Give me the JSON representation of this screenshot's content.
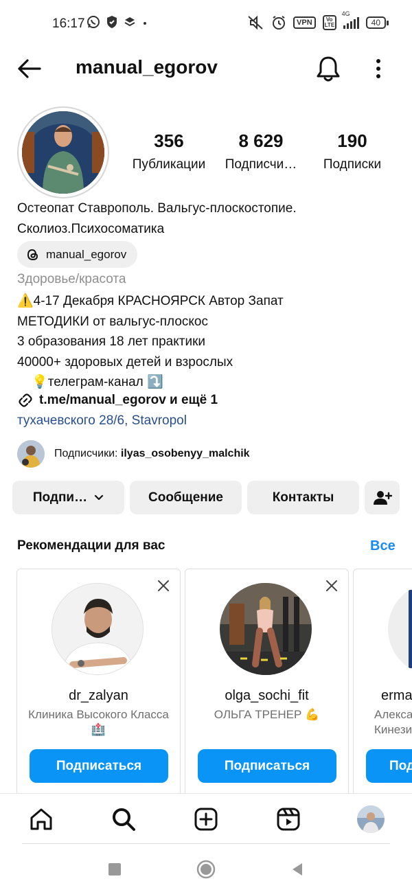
{
  "status_bar": {
    "time": "16:17",
    "left_icons": [
      "whatsapp-icon",
      "shield-icon",
      "layers-icon",
      "dot-icon"
    ],
    "right_icons": [
      "mute-icon",
      "alarm-icon",
      "vpn-badge",
      "volte-badge",
      "signal-4g-icon",
      "battery-icon"
    ],
    "vpn_label": "VPN",
    "volte_label": "Vo LTE",
    "network_label": "4G",
    "battery_level": "40"
  },
  "header": {
    "username": "manual_egorov",
    "back_icon": "arrow-left-icon",
    "bell_icon": "bell-icon",
    "more_icon": "more-vertical-icon"
  },
  "profile": {
    "stats": [
      {
        "value": "356",
        "label": "Публикации"
      },
      {
        "value": "8 629",
        "label": "Подписчи…"
      },
      {
        "value": "190",
        "label": "Подписки"
      }
    ],
    "name_line1": "Остеопат Ставрополь. Вальгус-плоскостопие.",
    "name_line2": "Сколиоз.Психосоматика",
    "threads_handle": "manual_egorov",
    "category": "Здоровье/красота",
    "bio": [
      "⚠️4-17 Декабря КРАСНОЯРСК Автор Запат",
      "МЕТОДИКИ от вальгус-плоскос",
      "3 образования 18 лет практики",
      "40000+ здоровых детей и взрослых",
      "    💡телеграм-канал ⤵️"
    ],
    "link": "t.me/manual_egorov и ещё 1",
    "address": "тухачевского 28/6, Stavropol",
    "followed_prefix": "Подписчики: ",
    "followed_user": "ilyas_osobenyy_malchik"
  },
  "actions": {
    "following_label": "Подпи…",
    "message_label": "Сообщение",
    "contacts_label": "Контакты",
    "add_user_icon": "add-user-icon"
  },
  "recommendations": {
    "title": "Рекомендации для вас",
    "see_all": "Все",
    "cards": [
      {
        "username": "dr_zalyan",
        "description": "Клиника Высокого Класса🏥",
        "follow_label": "Подписаться"
      },
      {
        "username": "olga_sochi_fit",
        "description": "ОЛЬГА ТРЕНЕР 💪",
        "follow_label": "Подписаться"
      },
      {
        "username": "erma",
        "description": "Алекса | Кинези",
        "follow_label": "Под"
      }
    ]
  },
  "bottom_nav": [
    "home-icon",
    "search-icon",
    "create-icon",
    "reels-icon",
    "profile-avatar"
  ],
  "colors": {
    "accent_blue": "#0a95f6",
    "link_blue": "#284e8d",
    "chip_gray": "#efefef",
    "muted_text": "#8e8e8e"
  }
}
